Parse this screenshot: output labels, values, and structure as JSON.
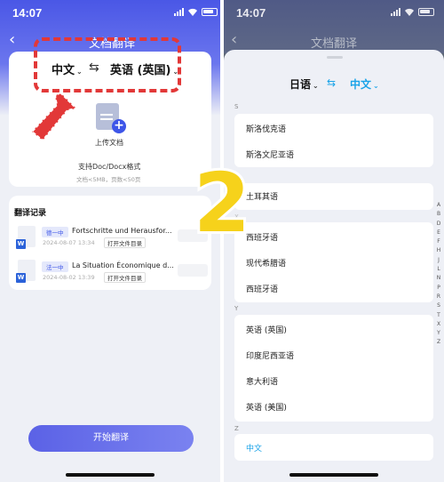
{
  "left": {
    "status_time": "14:07",
    "nav_title": "文档翻译",
    "source_lang": "中文",
    "target_lang": "英语 (英国)",
    "upload_label": "上传文档",
    "format_hint": "支持Doc/Docx格式",
    "size_hint": "文档<5MB，页数<50页",
    "history_title": "翻译记录",
    "history": [
      {
        "status": "德一中",
        "name": "Fortschritte und Herausfor...",
        "date": "2024-08-07 13:34",
        "action": "打开文件目录"
      },
      {
        "status": "法一中",
        "name": "La Situation Économique d...",
        "date": "2024-08-02 13:39",
        "action": "打开文件目录"
      }
    ],
    "start_button": "开始翻译"
  },
  "right": {
    "status_time": "14:07",
    "nav_title": "文档翻译",
    "source_lang": "日语",
    "target_lang": "中文",
    "sections": [
      {
        "letter": "S",
        "items": [
          "斯洛伐克语",
          "斯洛文尼亚语"
        ]
      },
      {
        "letter": "T",
        "items": [
          "土耳其语"
        ]
      },
      {
        "letter": "X",
        "items": [
          "西班牙语",
          "现代希腊语",
          "西班牙语"
        ]
      },
      {
        "letter": "Y",
        "items": [
          "英语 (英国)",
          "印度尼西亚语",
          "意大利语",
          "英语 (美国)"
        ]
      },
      {
        "letter": "Z",
        "items": [
          "中文"
        ]
      }
    ],
    "index_letters": [
      "A",
      "B",
      "D",
      "E",
      "F",
      "H",
      "J",
      "L",
      "N",
      "P",
      "R",
      "S",
      "T",
      "X",
      "Y",
      "Z"
    ]
  },
  "overlay_number": "2",
  "colors": {
    "accent": "#3d55e8",
    "annotation_red": "#e23838",
    "overlay_yellow": "#f6d21b",
    "selected_blue": "#1aa3e8"
  }
}
